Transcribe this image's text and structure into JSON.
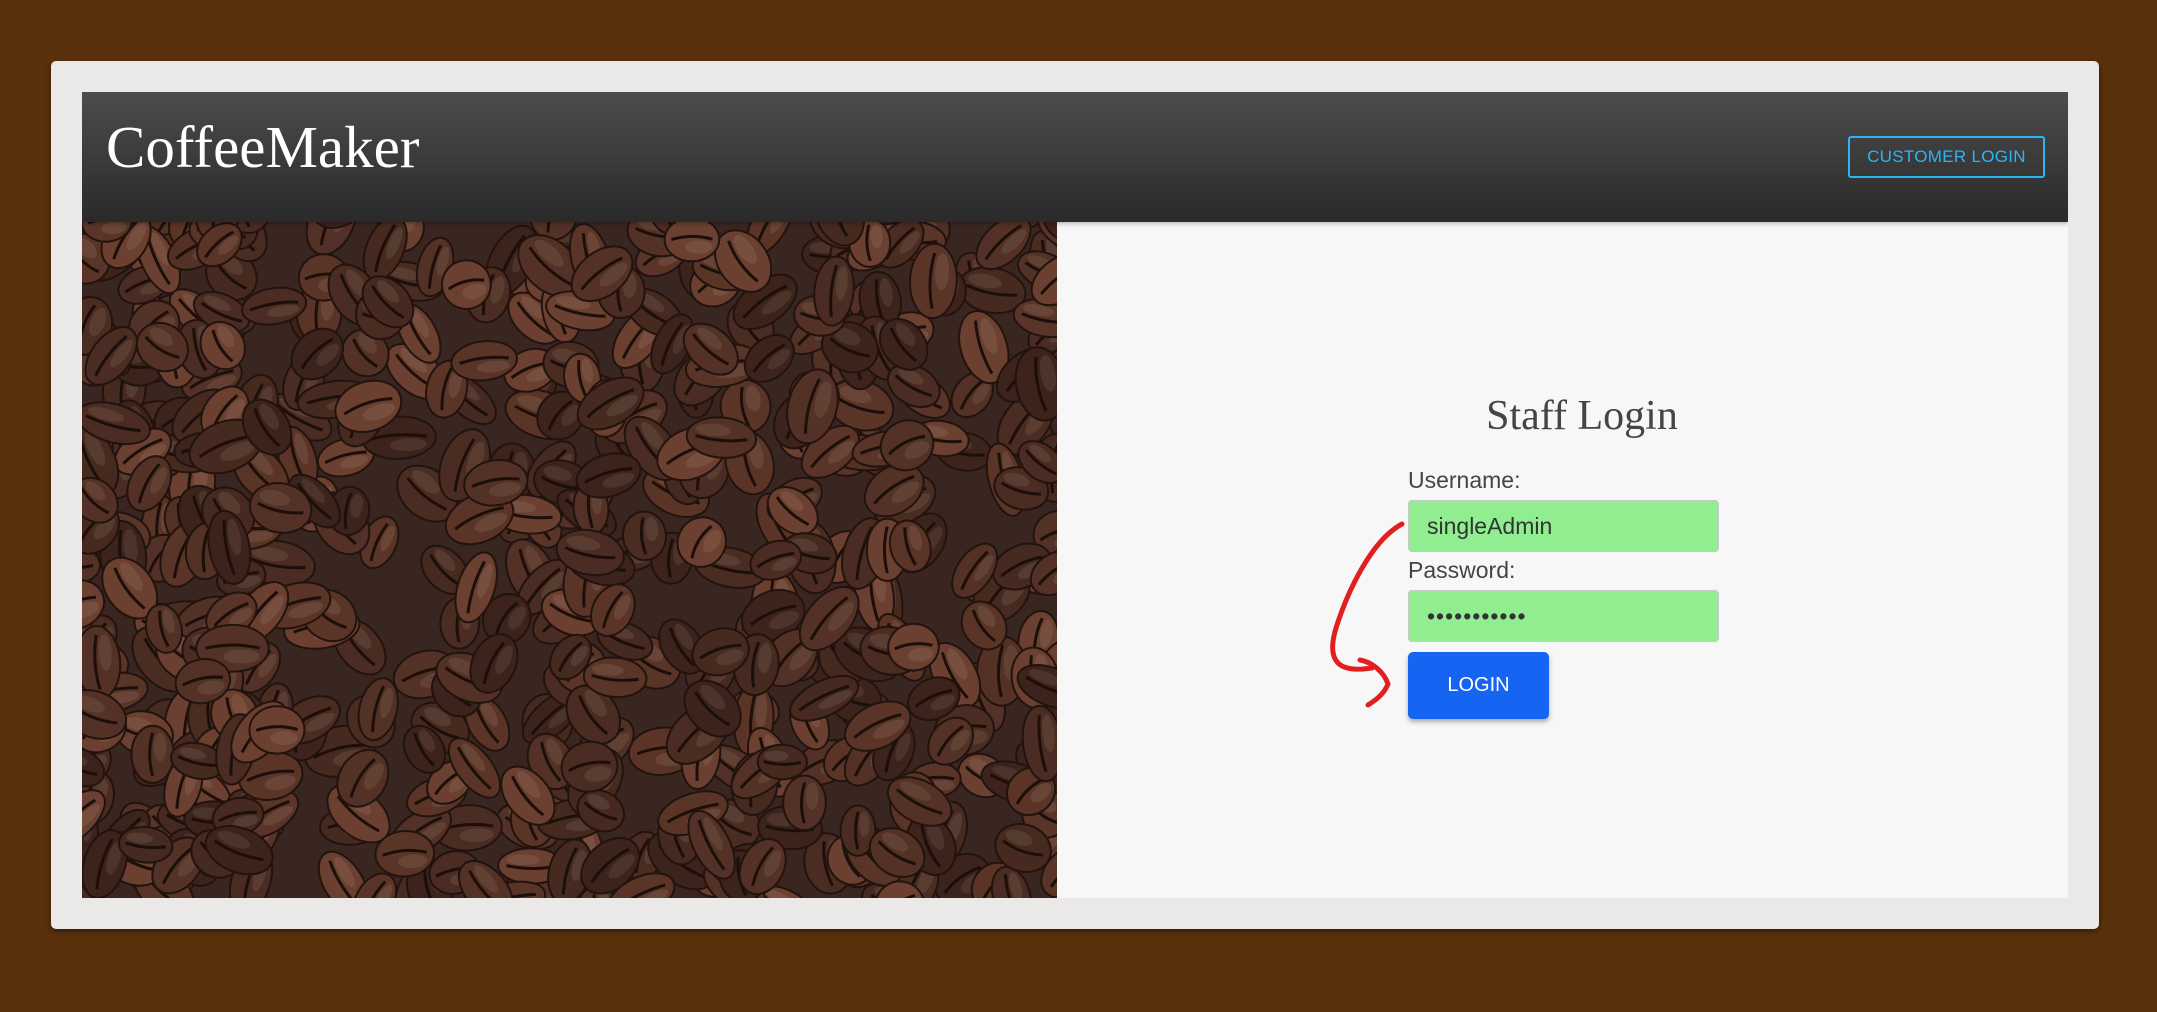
{
  "header": {
    "brand": "CoffeeMaker",
    "customer_login_label": "CUSTOMER LOGIN"
  },
  "hero": {
    "image": "coffee-beans-photo"
  },
  "login": {
    "title": "Staff Login",
    "username_label": "Username:",
    "username_value": "singleAdmin",
    "password_label": "Password:",
    "password_value": "•••••••••••",
    "login_label": "LOGIN"
  },
  "colors": {
    "page_bg": "#5a310c",
    "header_bg": "#333333",
    "accent": "#29b6f6",
    "field_bg": "#90ee90",
    "button": "#1565f2",
    "annotation": "#e02020"
  }
}
